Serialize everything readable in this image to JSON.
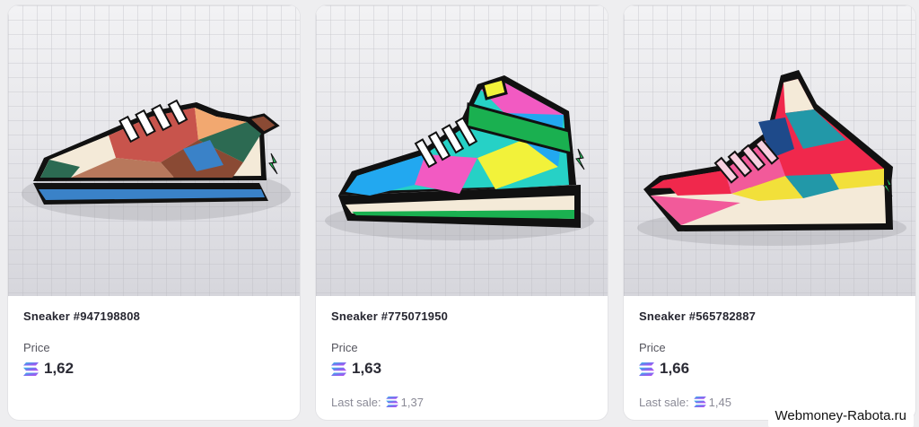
{
  "cards": [
    {
      "title": "Sneaker #947198808",
      "price_label": "Price",
      "price": "1,62",
      "last_sale_label": "",
      "last_sale": "",
      "shoe_icon": "sneaker-low-icon",
      "palette": [
        "#c8544c",
        "#8a4a34",
        "#f2a870",
        "#2c6a52",
        "#3a82c8"
      ]
    },
    {
      "title": "Sneaker #775071950",
      "price_label": "Price",
      "price": "1,63",
      "last_sale_label": "Last sale:",
      "last_sale": "1,37",
      "shoe_icon": "sneaker-high-icon",
      "palette": [
        "#26d1c6",
        "#f2f23a",
        "#f25ac2",
        "#1ab050",
        "#22a8f0"
      ]
    },
    {
      "title": "Sneaker #565782887",
      "price_label": "Price",
      "price": "1,66",
      "last_sale_label": "Last sale:",
      "last_sale": "1,45",
      "shoe_icon": "sneaker-high-icon",
      "palette": [
        "#f0284c",
        "#2298a8",
        "#f2e03a",
        "#f25a9a",
        "#1e4a8a"
      ]
    }
  ],
  "currency_icon": "solana-icon",
  "watermark": "Webmoney-Rabota.ru"
}
